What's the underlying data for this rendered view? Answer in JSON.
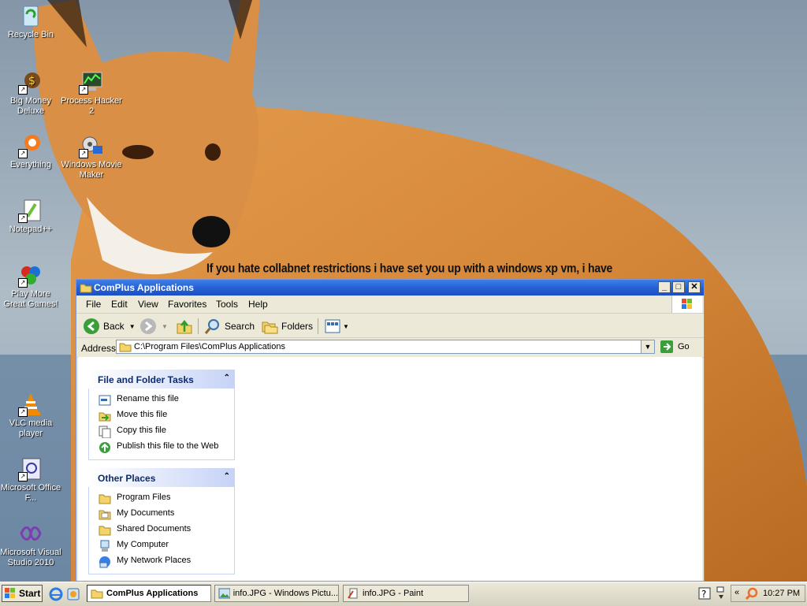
{
  "desktop": {
    "caption": "If you hate collabnet restrictions i have set you up with a windows xp vm, i have",
    "icons": [
      {
        "label": "Recycle Bin",
        "icon": "recycle-bin-icon"
      },
      {
        "label": "Big Money Deluxe",
        "icon": "big-money-icon"
      },
      {
        "label": "Process Hacker 2",
        "icon": "process-hacker-icon"
      },
      {
        "label": "Everything",
        "icon": "everything-icon"
      },
      {
        "label": "Windows Movie Maker",
        "icon": "movie-maker-icon"
      },
      {
        "label": "Notepad++",
        "icon": "notepad-plus-icon"
      },
      {
        "label": "Play More Great Games!",
        "icon": "games-icon"
      },
      {
        "label": "VLC media player",
        "icon": "vlc-icon"
      },
      {
        "label": "Microsoft Office F...",
        "icon": "office-icon"
      },
      {
        "label": "Microsoft Visual Studio 2010",
        "icon": "visual-studio-icon"
      }
    ]
  },
  "window": {
    "title": "ComPlus Applications",
    "menu": [
      "File",
      "Edit",
      "View",
      "Favorites",
      "Tools",
      "Help"
    ],
    "toolbar": {
      "back": "Back",
      "search": "Search",
      "folders": "Folders"
    },
    "address": {
      "label": "Address",
      "path": "C:\\Program Files\\ComPlus Applications",
      "go": "Go"
    },
    "panels": {
      "tasks": {
        "title": "File and Folder Tasks",
        "items": [
          "Rename this file",
          "Move this file",
          "Copy this file",
          "Publish this file to the Web"
        ]
      },
      "places": {
        "title": "Other Places",
        "items": [
          "Program Files",
          "My Documents",
          "Shared Documents",
          "My Computer",
          "My Network Places"
        ]
      }
    }
  },
  "taskbar": {
    "start": "Start",
    "buttons": [
      "ComPlus Applications",
      "info.JPG - Windows Pictu...",
      "info.JPG - Paint"
    ],
    "clock": "10:27 PM"
  },
  "colors": {
    "title_bar": "#2661d6",
    "panel_header": "#c6d3f7",
    "desktop_sky": "#a9b8c4",
    "fox": "#d88b3f"
  }
}
